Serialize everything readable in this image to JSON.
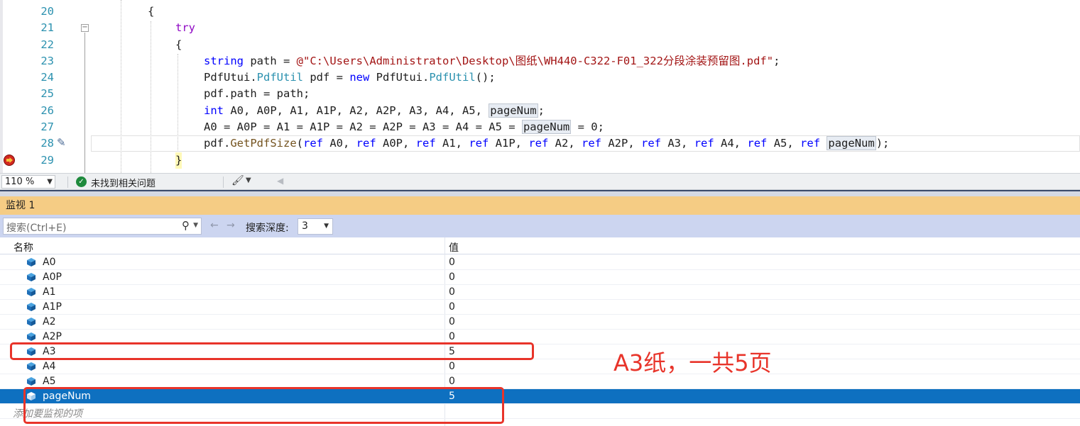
{
  "editor": {
    "lines": [
      {
        "num": "20",
        "code": "{"
      },
      {
        "num": "21",
        "code": "try"
      },
      {
        "num": "22",
        "code": "{"
      },
      {
        "num": "23",
        "code": "string path = @\"C:\\Users\\Administrator\\Desktop\\图纸\\WH440-C322-F01_322分段涂装预留图.pdf\";"
      },
      {
        "num": "24",
        "code": "PdfUtui.PdfUtil pdf = new PdfUtui.PdfUtil();"
      },
      {
        "num": "25",
        "code": "pdf.path = path;"
      },
      {
        "num": "26",
        "code": "int A0, A0P, A1, A1P, A2, A2P, A3, A4, A5, pageNum;"
      },
      {
        "num": "27",
        "code": "A0 = A0P = A1 = A1P = A2 = A2P = A3 = A4 = A5 = pageNum = 0;"
      },
      {
        "num": "28",
        "code": "pdf.GetPdfSize(ref A0, ref A0P, ref A1, ref A1P, ref A2, ref A2P, ref A3, ref A4, ref A5, ref pageNum);"
      },
      {
        "num": "29",
        "code": "}"
      }
    ],
    "tokens": {
      "try": "try",
      "string": "string",
      "path_var": "path",
      "string_literal": "@\"C:\\Users\\Administrator\\Desktop\\图纸\\WH440-C322-F01_322分段涂装预留图.pdf\"",
      "pdfutui": "PdfUtui",
      "pdfutil": "PdfUtil",
      "new": "new",
      "int": "int",
      "ref": "ref",
      "pagenum": "pageNum"
    }
  },
  "status_bar": {
    "zoom": "110 %",
    "issues_text": "未找到相关问题"
  },
  "watch": {
    "title": "监视 1",
    "search_placeholder": "搜索(Ctrl+E)",
    "depth_label": "搜索深度:",
    "depth_value": "3",
    "col_name": "名称",
    "col_value": "值",
    "rows": [
      {
        "name": "A0",
        "value": "0"
      },
      {
        "name": "A0P",
        "value": "0"
      },
      {
        "name": "A1",
        "value": "0"
      },
      {
        "name": "A1P",
        "value": "0"
      },
      {
        "name": "A2",
        "value": "0"
      },
      {
        "name": "A2P",
        "value": "0"
      },
      {
        "name": "A3",
        "value": "5"
      },
      {
        "name": "A4",
        "value": "0"
      },
      {
        "name": "A5",
        "value": "0"
      },
      {
        "name": "pageNum",
        "value": "5"
      }
    ],
    "add_item_placeholder": "添加要监视的项"
  },
  "annotation": {
    "note": "A3纸，一共5页",
    "color": "#e8342a"
  },
  "colors": {
    "keyword": "#0000ff",
    "control_keyword": "#8f08c4",
    "type": "#2b91af",
    "string": "#a31515",
    "watch_title_bg": "#f5cc84",
    "selection": "#0e70c0"
  }
}
